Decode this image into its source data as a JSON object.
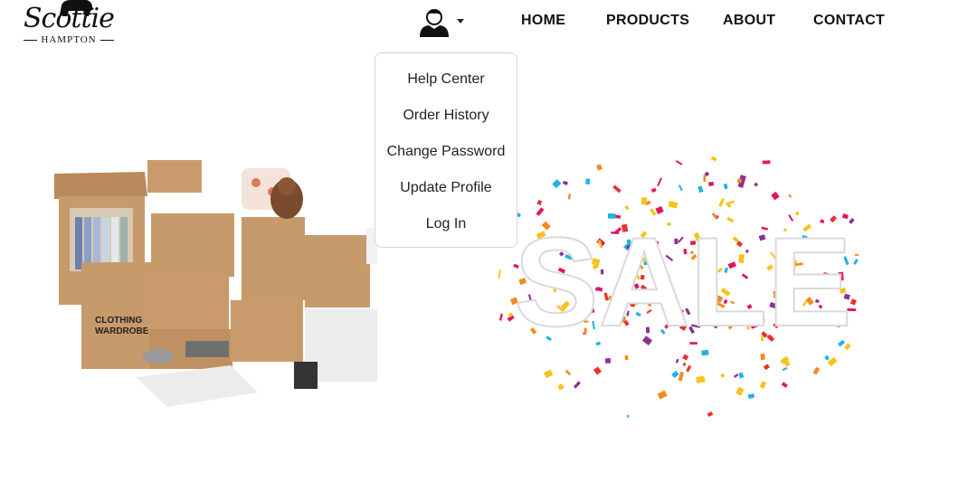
{
  "brand": {
    "name_script": "Scottie",
    "name_sub": "HAMPTON"
  },
  "header": {
    "account_icon": "user-icon",
    "nav": [
      "HOME",
      "PRODUCTS",
      "ABOUT",
      "CONTACT"
    ]
  },
  "account_menu": {
    "items": [
      "Help Center",
      "Order History",
      "Change Password",
      "Update Profile",
      "Log In"
    ]
  },
  "hero": {
    "left_image": "moving-boxes-image",
    "right_image": "sale-banner-image",
    "sale_text": "SALE"
  },
  "colors": {
    "text": "#111111",
    "border": "#d6d6d6",
    "box_brown": "#c79a6b"
  }
}
